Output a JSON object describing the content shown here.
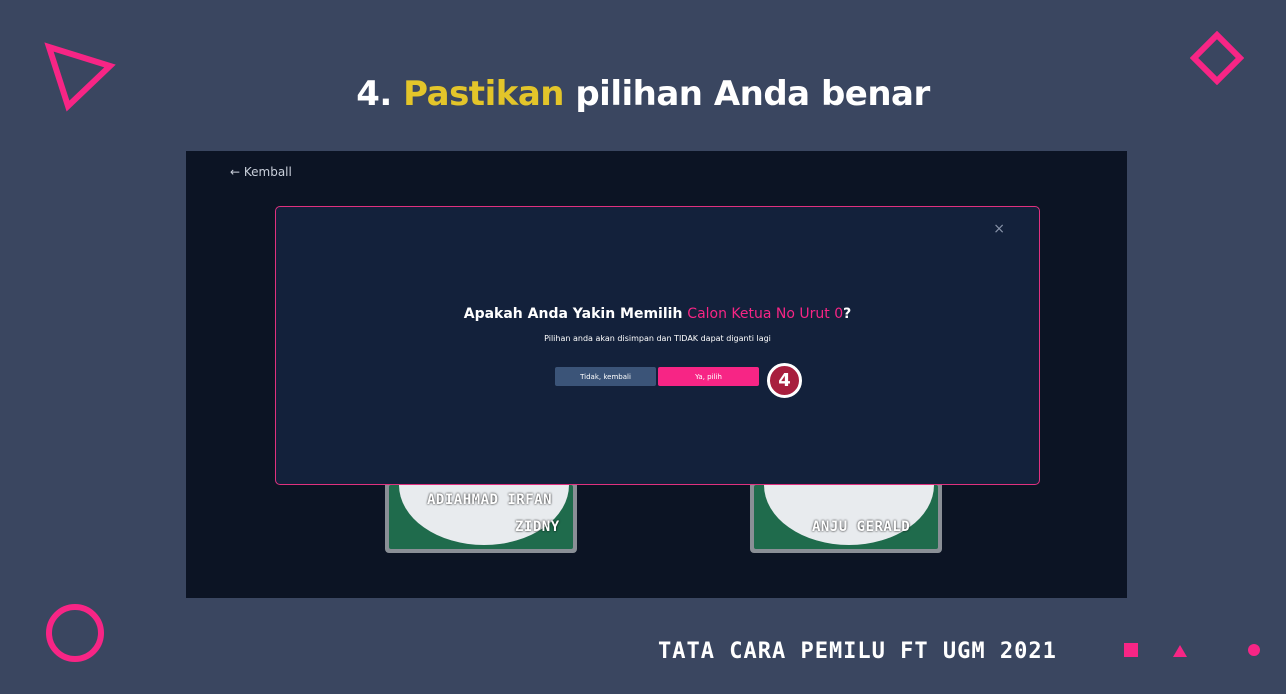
{
  "slide": {
    "title_prefix": "4.",
    "title_highlight": "Pastikan",
    "title_rest": "pilihan Anda benar",
    "footer": "TATA CARA PEMILU FT UGM 2021"
  },
  "app": {
    "back_label": "← Kemball",
    "candidates": [
      {
        "name_line1": "ADIAHMAD IRFAN",
        "name_line2": "ZIDNY"
      },
      {
        "name_line1": "ANJU GERALD"
      }
    ]
  },
  "modal": {
    "close": "×",
    "question_prefix": "Apakah Anda Yakin Memilih",
    "question_accent": "Calon Ketua No Urut 0",
    "question_suffix": "?",
    "subtitle": "Pilihan anda akan disimpan dan TIDAK dapat diganti lagi",
    "cancel_label": "Tidak, kembali",
    "confirm_label": "Ya, pilih",
    "step_number": "4"
  },
  "colors": {
    "background": "#3a4660",
    "accent_pink": "#f72585",
    "highlight_yellow": "#e3c52a",
    "modal_bg": "#13213b"
  },
  "icons": [
    "triangle-outline-icon",
    "diamond-outline-icon",
    "circle-outline-icon",
    "square-icon",
    "triangle-icon",
    "dot-icon",
    "close-icon"
  ]
}
